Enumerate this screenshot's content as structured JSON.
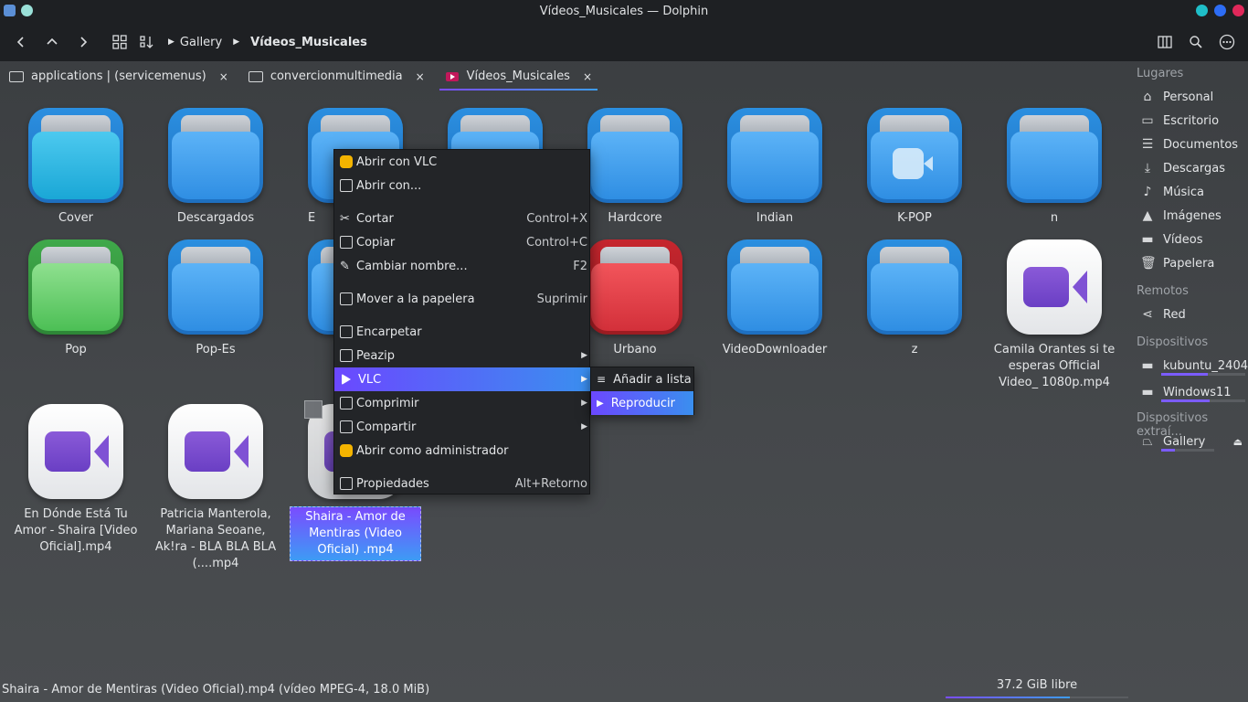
{
  "window": {
    "title": "Vídeos_Musicales — Dolphin",
    "colors": {
      "close": "#e0285a",
      "max": "#2d6df6",
      "min": "#1fbfc9"
    }
  },
  "toolbar": {
    "breadcrumb": [
      "Gallery",
      "Vídeos_Musicales"
    ]
  },
  "tabs": [
    {
      "label": "applications | (servicemenus)",
      "close": "×"
    },
    {
      "label": "convercionmultimedia",
      "close": "×"
    },
    {
      "label": "Vídeos_Musicales",
      "close": "×"
    }
  ],
  "files": [
    {
      "name": "Cover",
      "kind": "folder-cyan"
    },
    {
      "name": "Descargados",
      "kind": "folder"
    },
    {
      "name": "E",
      "kind": "folder"
    },
    {
      "name": "",
      "kind": "folder"
    },
    {
      "name": "Hardcore",
      "kind": "folder"
    },
    {
      "name": "Indian",
      "kind": "folder"
    },
    {
      "name": "K-POP",
      "kind": "folder-video"
    },
    {
      "name": "n",
      "kind": "folder"
    },
    {
      "name": "Pop",
      "kind": "folder-green"
    },
    {
      "name": "Pop-Es",
      "kind": "folder"
    },
    {
      "name": "",
      "kind": "folder"
    },
    {
      "name": "Urbano",
      "kind": "folder-red"
    },
    {
      "name": "VideoDownloader",
      "kind": "folder"
    },
    {
      "name": "z",
      "kind": "folder"
    },
    {
      "name": "Camila Orantes  si te esperas Official Video_ 1080p.mp4",
      "kind": "video"
    },
    {
      "name": "En Dónde Está Tu Amor - Shaira [Video Oficial].mp4",
      "kind": "video"
    },
    {
      "name": "Patricia Manterola, Mariana Seoane, Ak!ra - BLA BLA BLA (....mp4",
      "kind": "video"
    },
    {
      "name": "Shaira - Amor de Mentiras (Video Oficial) .mp4",
      "kind": "video",
      "selected": true
    }
  ],
  "context_menu": {
    "items": [
      {
        "label": "Abrir con VLC",
        "shortcut": ""
      },
      {
        "label": "Abrir con...",
        "shortcut": ""
      },
      {
        "label": "Cortar",
        "shortcut": "Control+X"
      },
      {
        "label": "Copiar",
        "shortcut": "Control+C"
      },
      {
        "label": "Cambiar nombre...",
        "shortcut": "F2"
      },
      {
        "label": "Mover a la papelera",
        "shortcut": "Suprimir"
      },
      {
        "label": "Encarpetar",
        "shortcut": ""
      },
      {
        "label": "Peazip",
        "shortcut": ""
      },
      {
        "label": "VLC",
        "shortcut": ""
      },
      {
        "label": "Comprimir",
        "shortcut": ""
      },
      {
        "label": "Compartir",
        "shortcut": ""
      },
      {
        "label": "Abrir como administrador",
        "shortcut": ""
      },
      {
        "label": "Propiedades",
        "shortcut": "Alt+Retorno"
      }
    ],
    "submenu": [
      {
        "label": "Añadir a lista"
      },
      {
        "label": "Reproducir"
      }
    ]
  },
  "sidebar": {
    "places_header": "Lugares",
    "places": [
      "Personal",
      "Escritorio",
      "Documentos",
      "Descargas",
      "Música",
      "Imágenes",
      "Vídeos",
      "Papelera"
    ],
    "remote_header": "Remotos",
    "remote": [
      "Red"
    ],
    "devices_header": "Dispositivos",
    "devices": [
      {
        "label": "kubuntu_2404",
        "usage": 0.55
      },
      {
        "label": "Windows11",
        "usage": 0.58
      }
    ],
    "removable_header": "Dispositivos extraí...",
    "removable": [
      {
        "label": "Gallery",
        "usage": 0.25,
        "eject": "⏏"
      }
    ]
  },
  "status": {
    "text": "Shaira - Amor de Mentiras (Video Oficial).mp4 (vídeo MPEG-4, 18.0 MiB)",
    "free": "37.2 GiB libre",
    "used_fraction": 0.68
  }
}
